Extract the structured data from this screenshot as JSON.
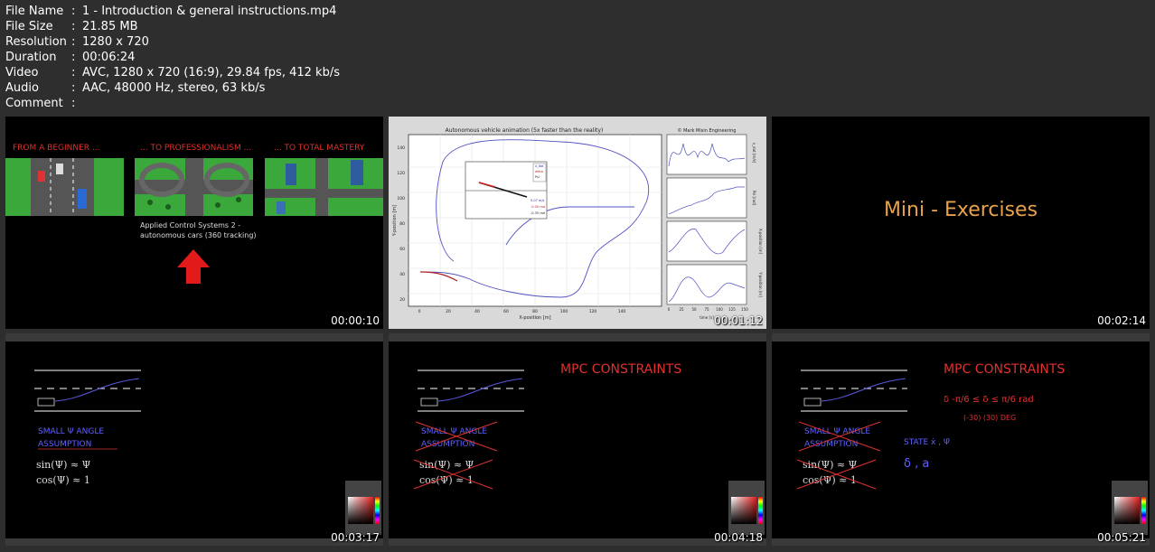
{
  "file_info": [
    {
      "key": "File Name",
      "value": "1 - Introduction & general instructions.mp4"
    },
    {
      "key": "File Size",
      "value": "21.85 MB"
    },
    {
      "key": "Resolution",
      "value": "1280 x 720"
    },
    {
      "key": "Duration",
      "value": "00:06:24"
    },
    {
      "key": "Video",
      "value": "AVC, 1280 x 720 (16:9), 29.84 fps, 412 kb/s"
    },
    {
      "key": "Audio",
      "value": "AAC, 48000 Hz, stereo, 63 kb/s"
    },
    {
      "key": "Comment",
      "value": ""
    }
  ],
  "separator": ":",
  "thumbnails": [
    {
      "timestamp": "00:00:10",
      "labels": [
        "FROM A BEGINNER ...",
        "... TO PROFESSIONALISM ...",
        "... TO TOTAL MASTERY"
      ],
      "caption_line1": "Applied Control Systems 2 -",
      "caption_line2": "autonomous cars (360 tracking)"
    },
    {
      "timestamp": "00:01:12",
      "plot_title": "Autonomous vehicle animation (5x faster than the reality)",
      "credit": "© Mark Misin Engineering",
      "xlabel": "X-position [m]",
      "ylabel": "Y-position [m]",
      "xticks": [
        "0",
        "20",
        "40",
        "60",
        "80",
        "100",
        "120",
        "140"
      ],
      "yticks": [
        "20",
        "40",
        "60",
        "80",
        "100",
        "120",
        "140"
      ],
      "right_ylabels": [
        "x_dot [m/s]",
        "Psi [rad]",
        "X-position [m]",
        "Y-position [m]"
      ],
      "right_xlabel": "time [s]",
      "right_xticks": [
        "0",
        "25",
        "50",
        "75",
        "100",
        "125",
        "150"
      ],
      "inset_legend": [
        "x_dot",
        "delta",
        "Psi"
      ],
      "inset_values": [
        "5.07 m/s",
        "-0.00 rad",
        "-0.35 rad"
      ]
    },
    {
      "timestamp": "00:02:14",
      "title": "Mini - Exercises"
    },
    {
      "timestamp": "00:03:17",
      "note_lines": [
        "SMALL Ψ ANGLE",
        "ASSUMPTION",
        "sin(Ψ) ≈ Ψ",
        "cos(Ψ) ≈ 1"
      ]
    },
    {
      "timestamp": "00:04:18",
      "header": "MPC CONSTRAINTS",
      "note_lines": [
        "SMALL Ψ ANGLE",
        "ASSUMPTION",
        "sin(Ψ) ≈ Ψ",
        "cos(Ψ) ≈ 1"
      ]
    },
    {
      "timestamp": "00:05:21",
      "header": "MPC CONSTRAINTS",
      "note_lines": [
        "SMALL Ψ ANGLE",
        "ASSUMPTION",
        "sin(Ψ) ≈ Ψ",
        "cos(Ψ) ≈ 1"
      ],
      "constraint_line": "δ   -π/6 ≤ δ ≤ π/6  rad",
      "constraint_deg": "(-30)      (30) DEG",
      "state_line": "STATE  ẋ , Ψ̇",
      "symbols": "δ , a"
    }
  ]
}
